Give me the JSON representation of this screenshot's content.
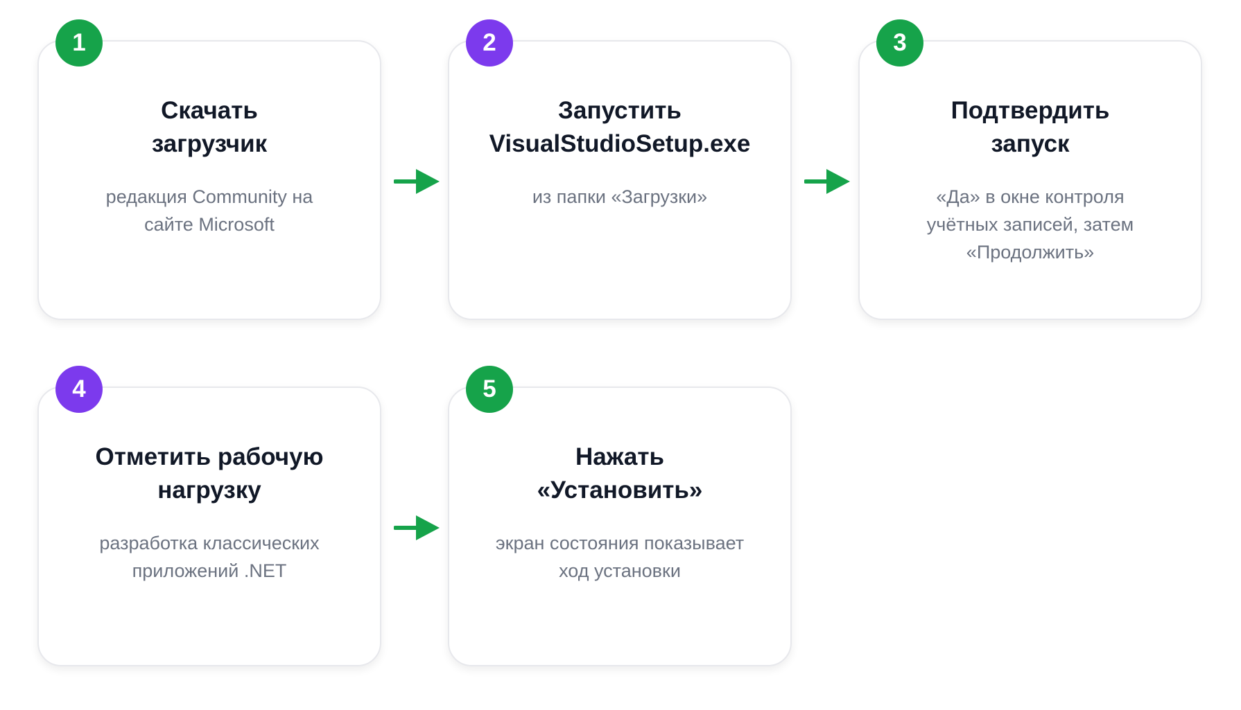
{
  "colors": {
    "green": "#16a34a",
    "purple": "#7c3aed",
    "arrow": "#16a34a"
  },
  "steps": [
    {
      "number": "1",
      "badge_color": "green",
      "title_lines": [
        "Скачать",
        "загрузчик"
      ],
      "desc_lines": [
        "редакция Community на",
        "сайте Microsoft"
      ]
    },
    {
      "number": "2",
      "badge_color": "purple",
      "title_lines": [
        "Запустить",
        "VisualStudioSetup.exe"
      ],
      "desc_lines": [
        "из папки «Загрузки»"
      ]
    },
    {
      "number": "3",
      "badge_color": "green",
      "title_lines": [
        "Подтвердить",
        "запуск"
      ],
      "desc_lines": [
        "«Да» в окне контроля",
        "учётных записей, затем",
        "«Продолжить»"
      ]
    },
    {
      "number": "4",
      "badge_color": "purple",
      "title_lines": [
        "Отметить рабочую",
        "нагрузку"
      ],
      "desc_lines": [
        "разработка классических",
        "приложений .NET"
      ]
    },
    {
      "number": "5",
      "badge_color": "green",
      "title_lines": [
        "Нажать",
        "«Установить»"
      ],
      "desc_lines": [
        "экран состояния показывает",
        "ход установки"
      ]
    }
  ]
}
